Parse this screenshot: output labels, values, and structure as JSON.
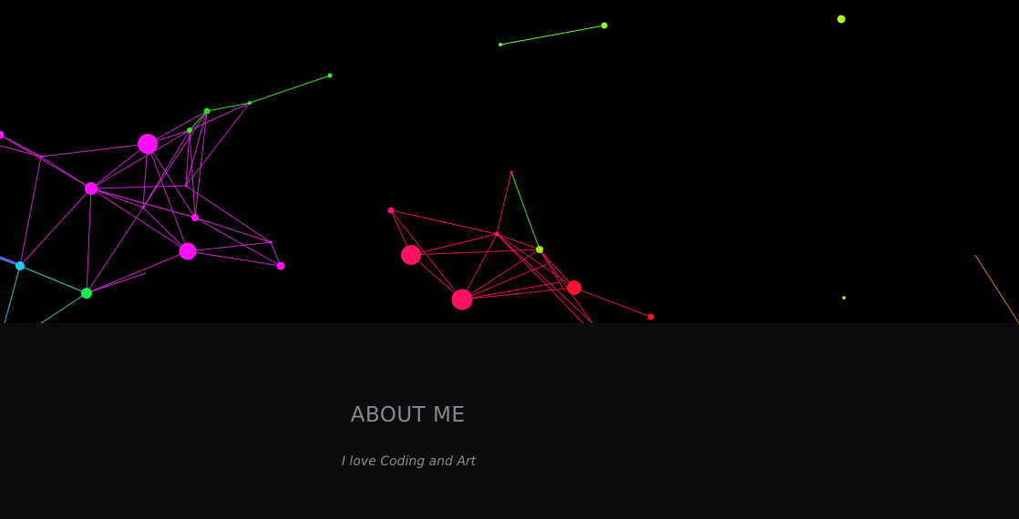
{
  "about": {
    "title": "ABOUT ME",
    "subtitle": "I love Coding and Art"
  }
}
